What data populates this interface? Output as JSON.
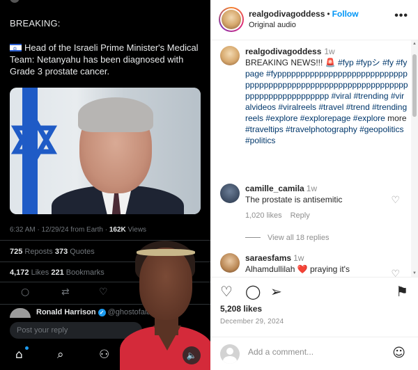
{
  "video": {
    "breaking_label": "BREAKING:",
    "tweet_text": "Head of the Israeli Prime Minister's Medical Team: Netanyahu has been diagnosed with Grade 3 prostate cancer.",
    "meta": {
      "time": "6:32 AM · 12/29/24 from Earth · ",
      "views_count": "162K",
      "views_label": " Views"
    },
    "stats": {
      "reposts_count": "725",
      "reposts_label": " Reposts  ",
      "quotes_count": "373",
      "quotes_label": " Quotes",
      "likes_count": "4,172",
      "likes_label": " Likes  ",
      "bookmarks_count": "221",
      "bookmarks_label": " Bookmarks"
    },
    "reply_user": {
      "name": "Ronald Harrison",
      "handle": "@ghostofala"
    },
    "reply_placeholder": "Post your reply",
    "mute_icon": "speaker-icon"
  },
  "ig": {
    "header": {
      "username": "realgodivagoddess",
      "separator": "•",
      "follow_label": "Follow",
      "audio": "Original audio",
      "more_label": "•••"
    },
    "caption": {
      "username": "realgodivagoddess",
      "time": "1w",
      "text_lead": "BREAKING NEWS!!! ",
      "siren": "🚨 ",
      "tags_1": "#fyp #fypシ #fy #fypage #fyppppppppppppppppppppppppppppppppppppppppppppppppppppppppppppppppppppppppppppppppp #viral #trending #viralvideos #viralreels #travel #trend #trendingreels #explore #explorepage #explore",
      "plain_mid": " more ",
      "tags_2": "#traveltips #travelphotography #geopolitics #politics"
    },
    "comments": [
      {
        "user": "camille_camila",
        "time": "1w",
        "text": "The prostate is antisemitic",
        "likes": "1,020 likes",
        "reply": "Reply"
      },
      {
        "user": "saraesfams",
        "time": "1w",
        "text": "Alhamdullilah ❤️ praying it's"
      }
    ],
    "view_replies": "View all 18 replies",
    "likes": "5,208 likes",
    "date": "December 29, 2024",
    "add_comment_placeholder": "Add a comment..."
  },
  "colors": {
    "accent": "#0095f6",
    "hashtag": "#00376b",
    "x_blue": "#1d9bf0",
    "bg_dark": "#000000"
  }
}
